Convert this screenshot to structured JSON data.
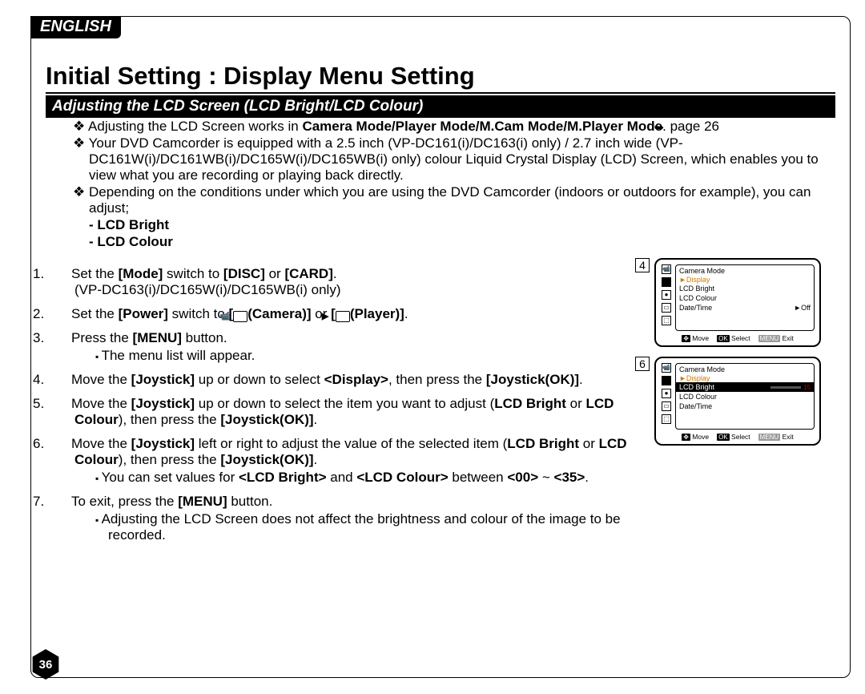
{
  "lang": "ENGLISH",
  "title": "Initial Setting : Display Menu Setting",
  "section": "Adjusting the LCD Screen (LCD Bright/LCD Colour)",
  "pageref_icon": "➥",
  "bullets_top": {
    "b1a": "Adjusting the LCD Screen works in ",
    "b1b": "Camera Mode/Player Mode/M.Cam Mode/M.Player Mode",
    "b1c": ". ",
    "b1d": "page 26",
    "b2": "Your DVD Camcorder is equipped with a 2.5 inch (VP-DC161(i)/DC163(i) only) / 2.7 inch wide (VP-DC161W(i)/DC161WB(i)/DC165W(i)/DC165WB(i) only) colour Liquid Crystal Display (LCD) Screen, which enables you to view what you are recording or playing back directly.",
    "b3": "Depending on the conditions under which you are using the DVD Camcorder (indoors or outdoors for example), you can adjust;"
  },
  "dash": {
    "d1": "LCD Bright",
    "d2": "LCD Colour"
  },
  "steps": {
    "s1a": "Set the ",
    "s1b": "[Mode]",
    "s1c": " switch to ",
    "s1d": "[DISC]",
    "s1e": " or ",
    "s1f": "[CARD]",
    "s1g": ".",
    "s1h": "(VP-DC163(i)/DC165W(i)/DC165WB(i) only)",
    "s2a": "Set the ",
    "s2b": "[Power]",
    "s2c": " switch to ",
    "s2d": "[",
    "s2e": "(Camera)]",
    "s2f": " or ",
    "s2g": "[",
    "s2h": "(Player)]",
    "s2i": ".",
    "s3a": "Press the ",
    "s3b": "[MENU]",
    "s3c": " button.",
    "s3sub": "The menu list will appear.",
    "s4a": "Move the ",
    "s4b": "[Joystick]",
    "s4c": " up or down to select ",
    "s4d": "<Display>",
    "s4e": ", then press the ",
    "s4f": "[Joystick(OK)]",
    "s4g": ".",
    "s5a": "Move the ",
    "s5b": "[Joystick]",
    "s5c": " up or down to select the item you want to adjust (",
    "s5d": "LCD Bright",
    "s5e": " or ",
    "s5f": "LCD Colour",
    "s5g": "), then press the ",
    "s5h": "[Joystick(OK)]",
    "s5i": ".",
    "s6a": "Move the ",
    "s6b": "[Joystick]",
    "s6c": " left or right to adjust the value of the selected item (",
    "s6d": "LCD Bright",
    "s6e": " or ",
    "s6f": "LCD Colour",
    "s6g": "), then press the ",
    "s6h": "[Joystick(OK)]",
    "s6i": ".",
    "s6sub_a": "You can set values for ",
    "s6sub_b": "<LCD Bright>",
    "s6sub_c": " and ",
    "s6sub_d": "<LCD Colour>",
    "s6sub_e": " between ",
    "s6sub_f": "<00>",
    "s6sub_g": " ~ ",
    "s6sub_h": "<35>",
    "s6sub_i": ".",
    "s7a": "To exit, press the ",
    "s7b": "[MENU]",
    "s7c": " button.",
    "s7sub": "Adjusting the LCD Screen does not affect the brightness and colour of the image to be recorded."
  },
  "fig4": {
    "num": "4",
    "mode": "Camera Mode",
    "display_label": "►Display",
    "rows": [
      "LCD Bright",
      "LCD Colour",
      "Date/Time"
    ],
    "off": "►Off",
    "ctrl_move": "Move",
    "ctrl_select": "Select",
    "ctrl_exit": "Exit",
    "ctrl_ok": "OK",
    "ctrl_menu": "MENU"
  },
  "fig6": {
    "num": "6",
    "mode": "Camera Mode",
    "display_label": "►Display",
    "rows": [
      "LCD Bright",
      "LCD Colour",
      "Date/Time"
    ],
    "bar_val": "15",
    "ctrl_move": "Move",
    "ctrl_select": "Select",
    "ctrl_exit": "Exit",
    "ctrl_ok": "OK",
    "ctrl_menu": "MENU"
  },
  "page_num": "36"
}
